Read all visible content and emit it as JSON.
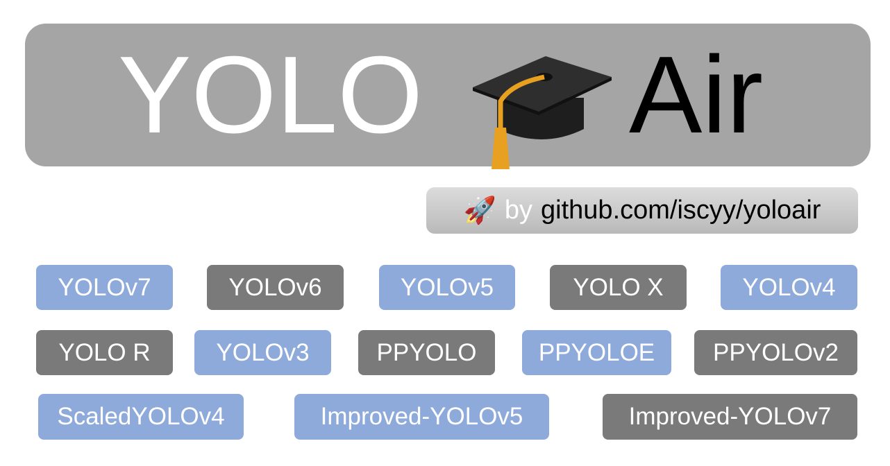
{
  "header": {
    "left": "YOLO",
    "right": "Air",
    "emoji": "graduation-cap"
  },
  "badge": {
    "emoji": "🚀",
    "by": "by",
    "url": "github.com/iscyy/yoloair"
  },
  "tags": [
    "YOLOv7",
    "YOLOv6",
    "YOLOv5",
    "YOLO X",
    "YOLOv4",
    "YOLO R",
    "YOLOv3",
    "PPYOLO",
    "PPYOLOE",
    "PPYOLOv2",
    "ScaledYOLOv4",
    "Improved-YOLOv5",
    "Improved-YOLOv7"
  ],
  "colors": {
    "blue": "#8eaadb",
    "gray": "#7a7a7a",
    "header": "#a5a5a5"
  }
}
